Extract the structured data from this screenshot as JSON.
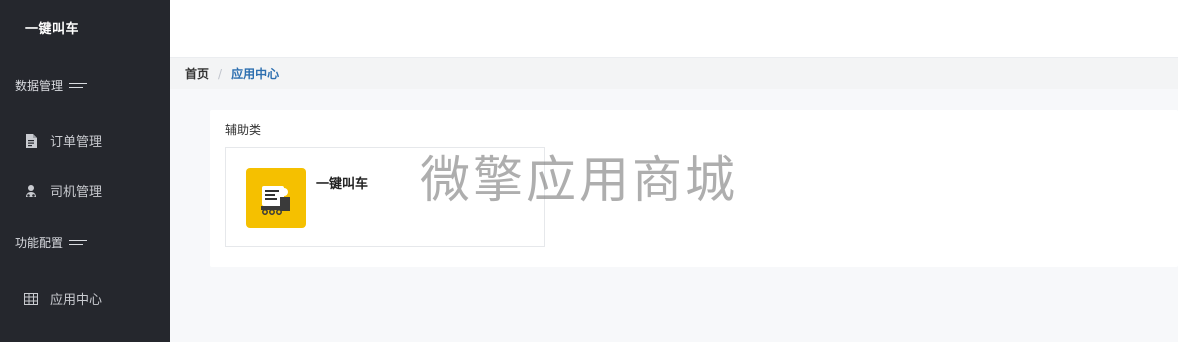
{
  "sidebar": {
    "app_title": "一键叫车",
    "groups": [
      {
        "title": "数据管理",
        "items": [
          {
            "label": "订单管理",
            "icon": "file-icon"
          },
          {
            "label": "司机管理",
            "icon": "driver-icon"
          }
        ]
      },
      {
        "title": "功能配置",
        "items": [
          {
            "label": "应用中心",
            "icon": "grid-icon"
          }
        ]
      }
    ]
  },
  "breadcrumb": {
    "home": "首页",
    "separator": "/",
    "current": "应用中心"
  },
  "main": {
    "section_title": "辅助类",
    "apps": [
      {
        "name": "一键叫车",
        "icon": "taxi-icon",
        "icon_color": "#f5c000"
      }
    ]
  },
  "watermark": "微擎应用商城",
  "colors": {
    "sidebar_bg": "#25272d",
    "accent": "#2d6fb0",
    "app_icon_bg": "#f5c000"
  }
}
